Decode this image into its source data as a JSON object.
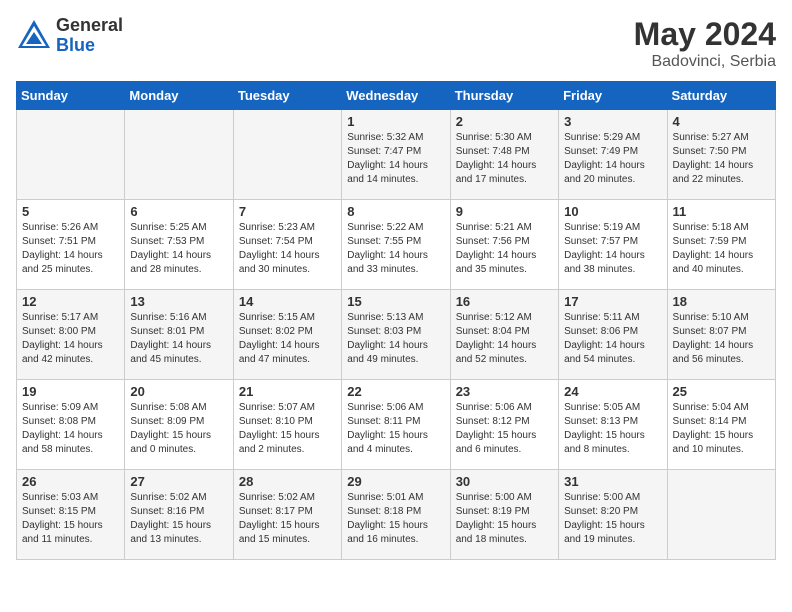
{
  "header": {
    "logo_general": "General",
    "logo_blue": "Blue",
    "month_title": "May 2024",
    "location": "Badovinci, Serbia"
  },
  "days_of_week": [
    "Sunday",
    "Monday",
    "Tuesday",
    "Wednesday",
    "Thursday",
    "Friday",
    "Saturday"
  ],
  "weeks": [
    {
      "days": [
        {
          "num": "",
          "info": ""
        },
        {
          "num": "",
          "info": ""
        },
        {
          "num": "",
          "info": ""
        },
        {
          "num": "1",
          "info": "Sunrise: 5:32 AM\nSunset: 7:47 PM\nDaylight: 14 hours and 14 minutes."
        },
        {
          "num": "2",
          "info": "Sunrise: 5:30 AM\nSunset: 7:48 PM\nDaylight: 14 hours and 17 minutes."
        },
        {
          "num": "3",
          "info": "Sunrise: 5:29 AM\nSunset: 7:49 PM\nDaylight: 14 hours and 20 minutes."
        },
        {
          "num": "4",
          "info": "Sunrise: 5:27 AM\nSunset: 7:50 PM\nDaylight: 14 hours and 22 minutes."
        }
      ]
    },
    {
      "days": [
        {
          "num": "5",
          "info": "Sunrise: 5:26 AM\nSunset: 7:51 PM\nDaylight: 14 hours and 25 minutes."
        },
        {
          "num": "6",
          "info": "Sunrise: 5:25 AM\nSunset: 7:53 PM\nDaylight: 14 hours and 28 minutes."
        },
        {
          "num": "7",
          "info": "Sunrise: 5:23 AM\nSunset: 7:54 PM\nDaylight: 14 hours and 30 minutes."
        },
        {
          "num": "8",
          "info": "Sunrise: 5:22 AM\nSunset: 7:55 PM\nDaylight: 14 hours and 33 minutes."
        },
        {
          "num": "9",
          "info": "Sunrise: 5:21 AM\nSunset: 7:56 PM\nDaylight: 14 hours and 35 minutes."
        },
        {
          "num": "10",
          "info": "Sunrise: 5:19 AM\nSunset: 7:57 PM\nDaylight: 14 hours and 38 minutes."
        },
        {
          "num": "11",
          "info": "Sunrise: 5:18 AM\nSunset: 7:59 PM\nDaylight: 14 hours and 40 minutes."
        }
      ]
    },
    {
      "days": [
        {
          "num": "12",
          "info": "Sunrise: 5:17 AM\nSunset: 8:00 PM\nDaylight: 14 hours and 42 minutes."
        },
        {
          "num": "13",
          "info": "Sunrise: 5:16 AM\nSunset: 8:01 PM\nDaylight: 14 hours and 45 minutes."
        },
        {
          "num": "14",
          "info": "Sunrise: 5:15 AM\nSunset: 8:02 PM\nDaylight: 14 hours and 47 minutes."
        },
        {
          "num": "15",
          "info": "Sunrise: 5:13 AM\nSunset: 8:03 PM\nDaylight: 14 hours and 49 minutes."
        },
        {
          "num": "16",
          "info": "Sunrise: 5:12 AM\nSunset: 8:04 PM\nDaylight: 14 hours and 52 minutes."
        },
        {
          "num": "17",
          "info": "Sunrise: 5:11 AM\nSunset: 8:06 PM\nDaylight: 14 hours and 54 minutes."
        },
        {
          "num": "18",
          "info": "Sunrise: 5:10 AM\nSunset: 8:07 PM\nDaylight: 14 hours and 56 minutes."
        }
      ]
    },
    {
      "days": [
        {
          "num": "19",
          "info": "Sunrise: 5:09 AM\nSunset: 8:08 PM\nDaylight: 14 hours and 58 minutes."
        },
        {
          "num": "20",
          "info": "Sunrise: 5:08 AM\nSunset: 8:09 PM\nDaylight: 15 hours and 0 minutes."
        },
        {
          "num": "21",
          "info": "Sunrise: 5:07 AM\nSunset: 8:10 PM\nDaylight: 15 hours and 2 minutes."
        },
        {
          "num": "22",
          "info": "Sunrise: 5:06 AM\nSunset: 8:11 PM\nDaylight: 15 hours and 4 minutes."
        },
        {
          "num": "23",
          "info": "Sunrise: 5:06 AM\nSunset: 8:12 PM\nDaylight: 15 hours and 6 minutes."
        },
        {
          "num": "24",
          "info": "Sunrise: 5:05 AM\nSunset: 8:13 PM\nDaylight: 15 hours and 8 minutes."
        },
        {
          "num": "25",
          "info": "Sunrise: 5:04 AM\nSunset: 8:14 PM\nDaylight: 15 hours and 10 minutes."
        }
      ]
    },
    {
      "days": [
        {
          "num": "26",
          "info": "Sunrise: 5:03 AM\nSunset: 8:15 PM\nDaylight: 15 hours and 11 minutes."
        },
        {
          "num": "27",
          "info": "Sunrise: 5:02 AM\nSunset: 8:16 PM\nDaylight: 15 hours and 13 minutes."
        },
        {
          "num": "28",
          "info": "Sunrise: 5:02 AM\nSunset: 8:17 PM\nDaylight: 15 hours and 15 minutes."
        },
        {
          "num": "29",
          "info": "Sunrise: 5:01 AM\nSunset: 8:18 PM\nDaylight: 15 hours and 16 minutes."
        },
        {
          "num": "30",
          "info": "Sunrise: 5:00 AM\nSunset: 8:19 PM\nDaylight: 15 hours and 18 minutes."
        },
        {
          "num": "31",
          "info": "Sunrise: 5:00 AM\nSunset: 8:20 PM\nDaylight: 15 hours and 19 minutes."
        },
        {
          "num": "",
          "info": ""
        }
      ]
    }
  ]
}
